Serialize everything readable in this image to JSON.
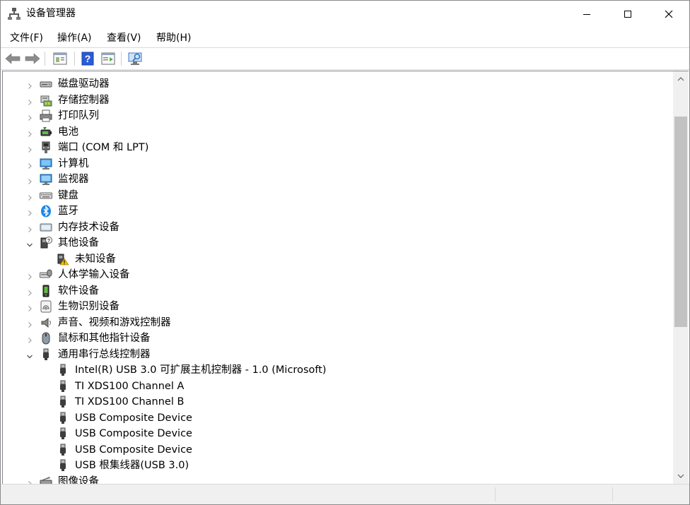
{
  "window": {
    "title": "设备管理器"
  },
  "menubar": {
    "items": [
      {
        "label": "文件(F)"
      },
      {
        "label": "操作(A)"
      },
      {
        "label": "查看(V)"
      },
      {
        "label": "帮助(H)"
      }
    ]
  },
  "toolbar": {
    "buttons": [
      "back-icon",
      "forward-icon",
      "properties-icon",
      "help-icon",
      "update-driver-icon",
      "scan-hardware-icon"
    ]
  },
  "tree": {
    "rows": [
      {
        "label": "磁盘驱动器",
        "expanded": false,
        "level": 0,
        "icon": "disk-drive-icon"
      },
      {
        "label": "存储控制器",
        "expanded": false,
        "level": 0,
        "icon": "storage-controller-icon"
      },
      {
        "label": "打印队列",
        "expanded": false,
        "level": 0,
        "icon": "printer-icon"
      },
      {
        "label": "电池",
        "expanded": false,
        "level": 0,
        "icon": "battery-icon"
      },
      {
        "label": "端口 (COM 和 LPT)",
        "expanded": false,
        "level": 0,
        "icon": "port-icon"
      },
      {
        "label": "计算机",
        "expanded": false,
        "level": 0,
        "icon": "computer-icon"
      },
      {
        "label": "监视器",
        "expanded": false,
        "level": 0,
        "icon": "monitor-icon"
      },
      {
        "label": "键盘",
        "expanded": false,
        "level": 0,
        "icon": "keyboard-icon"
      },
      {
        "label": "蓝牙",
        "expanded": false,
        "level": 0,
        "icon": "bluetooth-icon"
      },
      {
        "label": "内存技术设备",
        "expanded": false,
        "level": 0,
        "icon": "memory-device-icon"
      },
      {
        "label": "其他设备",
        "expanded": true,
        "level": 0,
        "icon": "other-devices-icon"
      },
      {
        "label": "未知设备",
        "level": 1,
        "icon": "unknown-device-warning-icon"
      },
      {
        "label": "人体学输入设备",
        "expanded": false,
        "level": 0,
        "icon": "hid-icon"
      },
      {
        "label": "软件设备",
        "expanded": false,
        "level": 0,
        "icon": "software-device-icon"
      },
      {
        "label": "生物识别设备",
        "expanded": false,
        "level": 0,
        "icon": "fingerprint-icon"
      },
      {
        "label": "声音、视频和游戏控制器",
        "expanded": false,
        "level": 0,
        "icon": "speaker-icon"
      },
      {
        "label": "鼠标和其他指针设备",
        "expanded": false,
        "level": 0,
        "icon": "mouse-icon"
      },
      {
        "label": "通用串行总线控制器",
        "expanded": true,
        "level": 0,
        "icon": "usb-controller-icon"
      },
      {
        "label": "Intel(R) USB 3.0 可扩展主机控制器 - 1.0 (Microsoft)",
        "level": 1,
        "icon": "usb-plug-icon"
      },
      {
        "label": "TI XDS100 Channel A",
        "level": 1,
        "icon": "usb-plug-icon"
      },
      {
        "label": "TI XDS100 Channel B",
        "level": 1,
        "icon": "usb-plug-icon"
      },
      {
        "label": "USB Composite Device",
        "level": 1,
        "icon": "usb-plug-icon"
      },
      {
        "label": "USB Composite Device",
        "level": 1,
        "icon": "usb-plug-icon"
      },
      {
        "label": "USB Composite Device",
        "level": 1,
        "icon": "usb-plug-icon"
      },
      {
        "label": "USB 根集线器(USB 3.0)",
        "level": 1,
        "icon": "usb-plug-icon"
      },
      {
        "label": "图像设备",
        "expanded": false,
        "level": 0,
        "icon": "imaging-device-icon"
      }
    ]
  },
  "colors": {
    "window_border": "#8a8a8a",
    "tree_border": "#828790",
    "statusbar_bg": "#f0f0f0",
    "scroll_thumb": "#c2c2c2",
    "help_icon_blue": "#2a5bd7",
    "warning_yellow": "#f4c20d"
  }
}
